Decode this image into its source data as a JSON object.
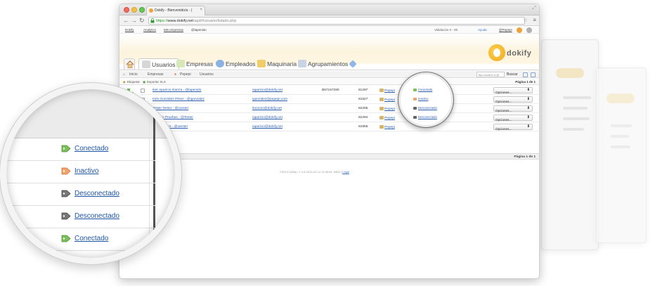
{
  "browser": {
    "tab_title": "Dokify - Bienvenido/a - (",
    "url_scheme": "https://",
    "url_host": "www.dokify.net",
    "url_path": "/agd/#usuario/listado.php"
  },
  "appbar": {
    "links": [
      "Dokify",
      "Analytics",
      "Mis empresas",
      "@lapenido"
    ],
    "validation": "Validación 0 - 90",
    "help": "Ayuda",
    "logout": "@Pepepi"
  },
  "logo": {
    "word": "dokify"
  },
  "nav": {
    "tabs": [
      "Usuarios",
      "Empresas",
      "Empleados",
      "Maquinaria",
      "Agrupamientos"
    ],
    "active": "Usuarios"
  },
  "subnav": {
    "crumbs": [
      "Inicio",
      "Empresas",
      "Pepepi",
      "Usuarios"
    ],
    "search_placeholder": "tipo:usuario a @",
    "search_button": "Buscar"
  },
  "toolbar": {
    "buttons": [
      "Etiquetar",
      "Exportar XLS"
    ],
    "page_label": "Página 1 de 1"
  },
  "table": {
    "rows": [
      {
        "name": "Iker Aparicio García - @lapenido",
        "email": "iaparicio@dokify.net",
        "phone": "B57157290",
        "code": "81297",
        "company": "Pepepi",
        "status": "Conectado",
        "options": "Opciones..."
      },
      {
        "name": "Inés González Pérez - @igonzalez",
        "email": "igonzalez@pepepi.com",
        "phone": "",
        "code": "81827",
        "company": "Pepepi",
        "status": "Inactivo",
        "options": "Opciones..."
      },
      {
        "name": "Tester Tester - @Ltester",
        "email": "itomozo@dokify.net",
        "phone": "",
        "code": "82295",
        "company": "Pepepi",
        "status": "Desconectado",
        "options": "Opciones..."
      },
      {
        "name": "Usuario Pruebas - @Tester",
        "email": "iaparicio@dokify.net",
        "phone": "",
        "code": "82294",
        "company": "Pepepi",
        "status": "Desconectado",
        "options": "Opciones..."
      },
      {
        "name": "Iker Aparicio - @utester",
        "email": "iaparicio@dokify.net",
        "phone": "",
        "code": "81855",
        "company": "Pepepi",
        "status": "Conectado",
        "options": "Opciones..."
      }
    ]
  },
  "footer": {
    "count": "1 al 5 de 5",
    "page_label": "Página 1 de 1",
    "copyright": "©2013 Dokify / 1.4.6-2013-02-14 11:08:04 -0800 |",
    "copyright_link": "Legal"
  },
  "magnifier": {
    "statuses": [
      "Conectado",
      "Inactivo",
      "Desconectado",
      "Desconectado",
      "Conectado"
    ]
  },
  "colors": {
    "connected": "#7cbf5a",
    "inactive": "#f0a36a",
    "disconnected": "#666666",
    "link": "#1f56a6",
    "brand": "#f0a71f"
  }
}
